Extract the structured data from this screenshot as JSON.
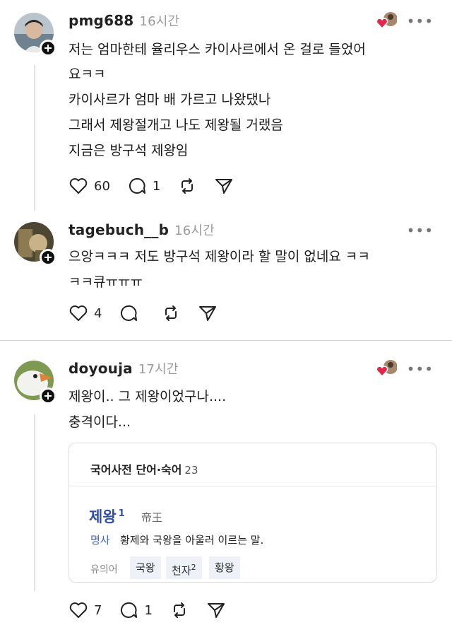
{
  "posts": [
    {
      "username": "pmg688",
      "time": "16시간",
      "more": "•••",
      "lines": [
        "저는 엄마한테 율리우스 카이사르에서 온 걸로 들었어",
        "요ㅋㅋ",
        "카이사르가 엄마 배 가르고 나왔댔나",
        "그래서 제왕절개고 나도 제왕될 거랬음",
        "지금은 방구석 제왕임"
      ],
      "likes": "60",
      "replies": "1"
    },
    {
      "username": "tagebuch__b",
      "time": "16시간",
      "more": "•••",
      "lines": [
        "으앙ㅋㅋㅋ 저도 방구석 제왕이라 할 말이 없네요 ㅋㅋ",
        "ㅋㅋ큐ㅠㅠㅠ"
      ],
      "likes": "4",
      "replies": ""
    },
    {
      "username": "doyouja",
      "time": "17시간",
      "more": "•••",
      "lines": [
        "제왕이.. 그 제왕이었구나....",
        "충격이다..."
      ],
      "likes": "7",
      "replies": "1"
    }
  ],
  "dict_card": {
    "title": "국어사전 단어·숙어",
    "count": "23",
    "word": "제왕",
    "word_sup": "1",
    "hanja": "帝王",
    "pos": "명사",
    "definition": "황제와 국왕을 아울러 이르는 말.",
    "synonym_label": "유의어",
    "synonyms": [
      "국왕",
      "천자",
      "황왕"
    ],
    "synonym_sup": "2"
  },
  "colors": {
    "dict_word": "#2f4fa8",
    "pos": "#3d64c9",
    "heart_badge": "#e3264b"
  }
}
